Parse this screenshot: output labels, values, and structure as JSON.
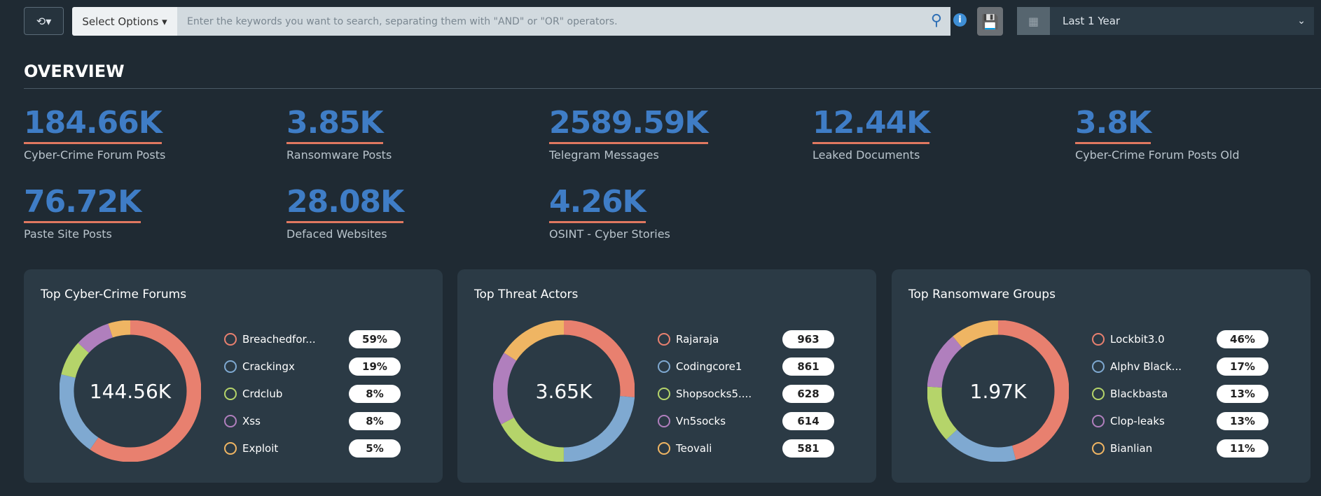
{
  "toolbar": {
    "history_icon": "history-icon",
    "select_label": "Select Options ▾",
    "search_placeholder": "Enter the keywords you want to search, separating them with \"AND\" or \"OR\" operators.",
    "date_range": "Last 1 Year"
  },
  "overview": {
    "title": "OVERVIEW",
    "stats": [
      {
        "value": "184.66K",
        "label": "Cyber-Crime Forum Posts"
      },
      {
        "value": "3.85K",
        "label": "Ransomware Posts"
      },
      {
        "value": "2589.59K",
        "label": "Telegram Messages"
      },
      {
        "value": "12.44K",
        "label": "Leaked Documents"
      },
      {
        "value": "3.8K",
        "label": "Cyber-Crime Forum Posts Old"
      },
      {
        "value": "76.72K",
        "label": "Paste Site Posts"
      },
      {
        "value": "28.08K",
        "label": "Defaced Websites"
      },
      {
        "value": "4.26K",
        "label": "OSINT - Cyber Stories"
      }
    ]
  },
  "colors": [
    "#e8806f",
    "#7fa9d1",
    "#b5d46a",
    "#b07fbd",
    "#efb563"
  ],
  "chart_data": [
    {
      "type": "pie",
      "title": "Top Cyber-Crime Forums",
      "total": "144.56K",
      "categories": [
        "Breachedfor...",
        "Crackingx",
        "Crdclub",
        "Xss",
        "Exploit"
      ],
      "values": [
        59,
        19,
        8,
        8,
        5
      ],
      "labels": [
        "59%",
        "19%",
        "8%",
        "8%",
        "5%"
      ]
    },
    {
      "type": "pie",
      "title": "Top Threat Actors",
      "total": "3.65K",
      "categories": [
        "Rajaraja",
        "Codingcore1",
        "Shopsocks5....",
        "Vn5socks",
        "Teovali"
      ],
      "values": [
        963,
        861,
        628,
        614,
        581
      ],
      "labels": [
        "963",
        "861",
        "628",
        "614",
        "581"
      ]
    },
    {
      "type": "pie",
      "title": "Top Ransomware Groups",
      "total": "1.97K",
      "categories": [
        "Lockbit3.0",
        "Alphv Black...",
        "Blackbasta",
        "Clop-leaks",
        "Bianlian"
      ],
      "values": [
        46,
        17,
        13,
        13,
        11
      ],
      "labels": [
        "46%",
        "17%",
        "13%",
        "13%",
        "11%"
      ]
    }
  ]
}
